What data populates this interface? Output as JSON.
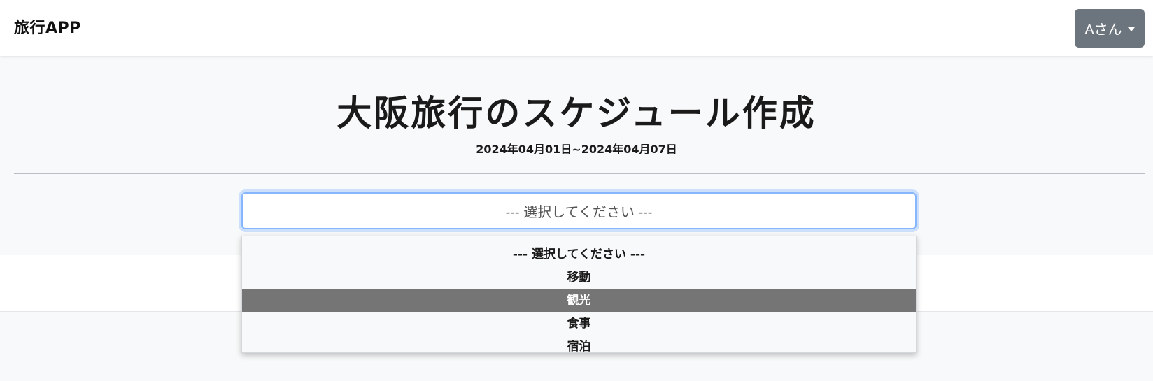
{
  "navbar": {
    "brand": "旅行APP",
    "user_menu_label": "Aさん"
  },
  "header": {
    "title": "大阪旅行のスケジュール作成",
    "date_range": "2024年04月01日~2024年04月07日"
  },
  "select": {
    "current_value": "--- 選択してください ---",
    "options": [
      {
        "label": "--- 選択してください ---",
        "highlighted": false
      },
      {
        "label": "移動",
        "highlighted": false
      },
      {
        "label": "観光",
        "highlighted": true
      },
      {
        "label": "食事",
        "highlighted": false
      },
      {
        "label": "宿泊",
        "highlighted": false
      }
    ]
  },
  "colors": {
    "user_button_bg": "#6c757d",
    "focus_border": "#86b7fe",
    "option_highlight_bg": "#757575",
    "page_bg": "#f8f9fa"
  }
}
